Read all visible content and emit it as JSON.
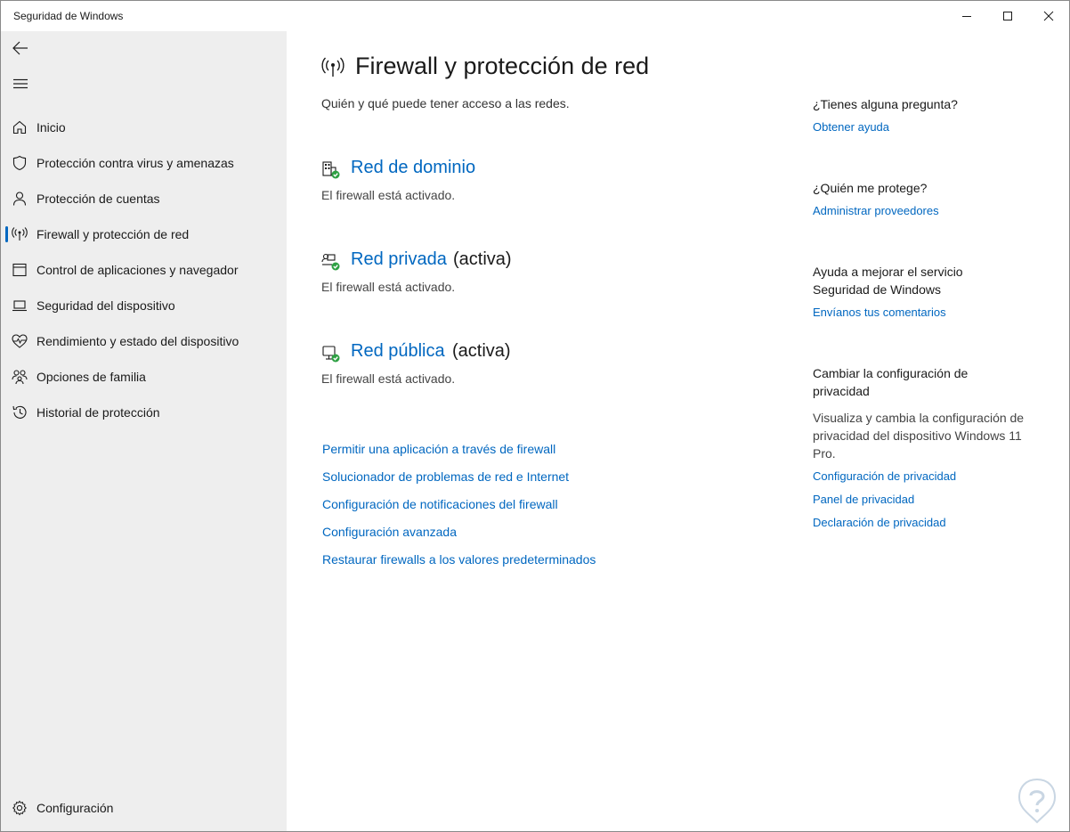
{
  "window": {
    "title": "Seguridad de Windows",
    "controls": [
      "minimize",
      "maximize",
      "close"
    ]
  },
  "sidebar": {
    "back_icon": "back-arrow-icon",
    "menu_icon": "hamburger-menu-icon",
    "items": [
      {
        "label": "Inicio",
        "icon": "home-icon"
      },
      {
        "label": "Protección contra virus y amenazas",
        "icon": "shield-icon"
      },
      {
        "label": "Protección de cuentas",
        "icon": "person-icon"
      },
      {
        "label": "Firewall y protección de red",
        "icon": "antenna-icon",
        "active": true
      },
      {
        "label": "Control de aplicaciones y navegador",
        "icon": "app-window-icon"
      },
      {
        "label": "Seguridad del dispositivo",
        "icon": "laptop-icon"
      },
      {
        "label": "Rendimiento y estado del dispositivo",
        "icon": "heart-pulse-icon"
      },
      {
        "label": "Opciones de familia",
        "icon": "family-icon"
      },
      {
        "label": "Historial de protección",
        "icon": "history-icon"
      }
    ],
    "settings": {
      "label": "Configuración",
      "icon": "gear-icon"
    }
  },
  "main": {
    "title": "Firewall y protección de red",
    "subtitle": "Quién y qué puede tener acceso a las redes.",
    "networks": [
      {
        "name": "Red de dominio",
        "tag": "",
        "status": "El firewall está activado.",
        "icon": "domain-network-icon"
      },
      {
        "name": "Red privada",
        "tag": "(activa)",
        "status": "El firewall está activado.",
        "icon": "private-network-icon"
      },
      {
        "name": "Red pública",
        "tag": "(activa)",
        "status": "El firewall está activado.",
        "icon": "public-network-icon"
      }
    ],
    "links": [
      "Permitir una aplicación a través de firewall",
      "Solucionador de problemas de red e Internet",
      "Configuración de notificaciones del firewall",
      "Configuración avanzada",
      "Restaurar firewalls a los valores predeterminados"
    ]
  },
  "aside": {
    "question": {
      "heading": "¿Tienes alguna pregunta?",
      "link": "Obtener ayuda"
    },
    "protector": {
      "heading": "¿Quién me protege?",
      "link": "Administrar proveedores"
    },
    "feedback": {
      "heading": "Ayuda a mejorar el servicio Seguridad de Windows",
      "link": "Envíanos tus comentarios"
    },
    "privacy": {
      "heading": "Cambiar la configuración de privacidad",
      "text": "Visualiza y cambia la configuración de privacidad del dispositivo Windows 11 Pro.",
      "links": [
        "Configuración de privacidad",
        "Panel de privacidad",
        "Declaración de privacidad"
      ]
    }
  },
  "colors": {
    "accent": "#0067c0",
    "sidebar_bg": "#eeeeee",
    "ok_green": "#2ea043"
  }
}
